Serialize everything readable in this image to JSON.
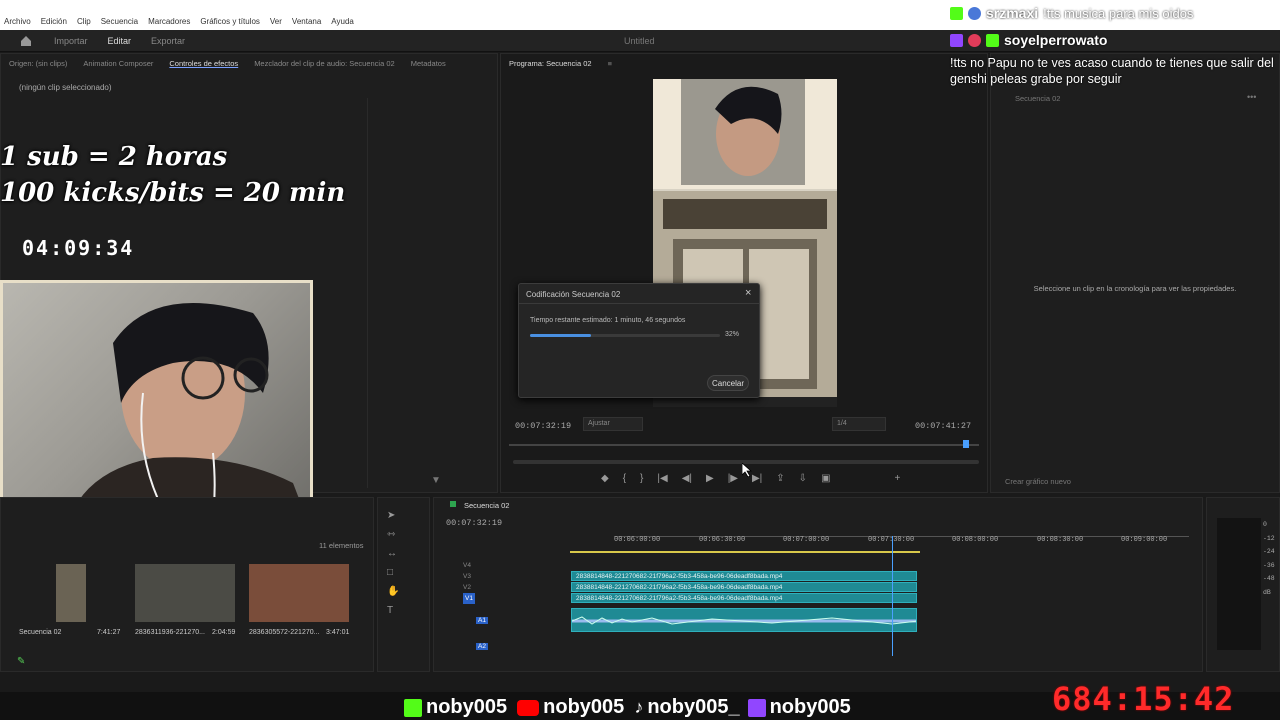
{
  "menu": [
    "Archivo",
    "Edición",
    "Clip",
    "Secuencia",
    "Marcadores",
    "Gráficos y títulos",
    "Ver",
    "Ventana",
    "Ayuda"
  ],
  "topbar": {
    "tabs": [
      "Importar",
      "Editar",
      "Exportar"
    ],
    "active": "Editar",
    "project_title": "Untitled"
  },
  "source_panel": {
    "tabs": [
      "Origen: (sin clips)",
      "Animation Composer",
      "Controles de efectos",
      "Mezclador del clip de audio: Secuencia 02",
      "Metadatos"
    ],
    "active_tab": "Controles de efectos",
    "empty_msg": "(ningún clip seleccionado)"
  },
  "overlay": {
    "line1": "1 sub = 2 horas",
    "line2": "100 kicks/bits = 20 min",
    "timer": "04:09:34"
  },
  "program": {
    "tab": "Programa: Secuencia 02",
    "timecode_left": "00:07:32:19",
    "fit": "Ajustar",
    "quality": "1/4",
    "timecode_right": "00:07:41:27"
  },
  "dialog": {
    "title": "Codificación Secuencia 02",
    "status": "Tiempo restante estimado: 1 minuto, 46 segundos",
    "percent_label": "32%",
    "progress": 0.32,
    "cancel": "Cancelar"
  },
  "properties": {
    "title": "Secuencia 02",
    "empty_msg": "Seleccione un clip en la cronología para ver las propiedades.",
    "button": "Crear gráfico nuevo"
  },
  "chat": [
    {
      "user": "srzmaxi",
      "msg": "!tts musica para mis oidos",
      "badge_color": "#53fc18"
    },
    {
      "user": "soyelperrowato",
      "msg": "!tts no Papu no te ves acaso cuando te tienes que salir del genshi peleas grabe por seguir",
      "badge_color": "#53fc18"
    }
  ],
  "project_bin": {
    "count": "11 elementos",
    "items": [
      {
        "name": "Secuencia 02",
        "dur": "7:41:27"
      },
      {
        "name": "2836311936-221270...",
        "dur": "2:04:59"
      },
      {
        "name": "2836305572-221270...",
        "dur": "3:47:01"
      }
    ]
  },
  "timeline": {
    "title": "Secuencia 02",
    "timecode": "00:07:32:19",
    "ruler": [
      "00:06:00:00",
      "00:06:30:00",
      "00:07:00:00",
      "00:07:30:00",
      "00:08:00:00",
      "00:08:30:00",
      "00:09:00:00"
    ],
    "video_tracks": [
      "V4",
      "V3",
      "V2",
      "V1"
    ],
    "audio_tracks": [
      "A1",
      "A2"
    ],
    "clip_name": "2838814848-221270682-21f796a2-f5b3-458a-be96-06deadf8bada.mp4",
    "meter_labels": [
      "0",
      "-12",
      "-24",
      "-36",
      "-48",
      "dB"
    ]
  },
  "footer": {
    "handles": [
      {
        "platform": "kick",
        "name": "noby005",
        "color": "#53fc18"
      },
      {
        "platform": "youtube",
        "name": "noby005",
        "color": "#ff0000"
      },
      {
        "platform": "tiktok",
        "name": "noby005_",
        "color": "#ffffff"
      },
      {
        "platform": "twitch",
        "name": "noby005",
        "color": "#9146ff"
      }
    ],
    "clock": "684:15:42"
  }
}
